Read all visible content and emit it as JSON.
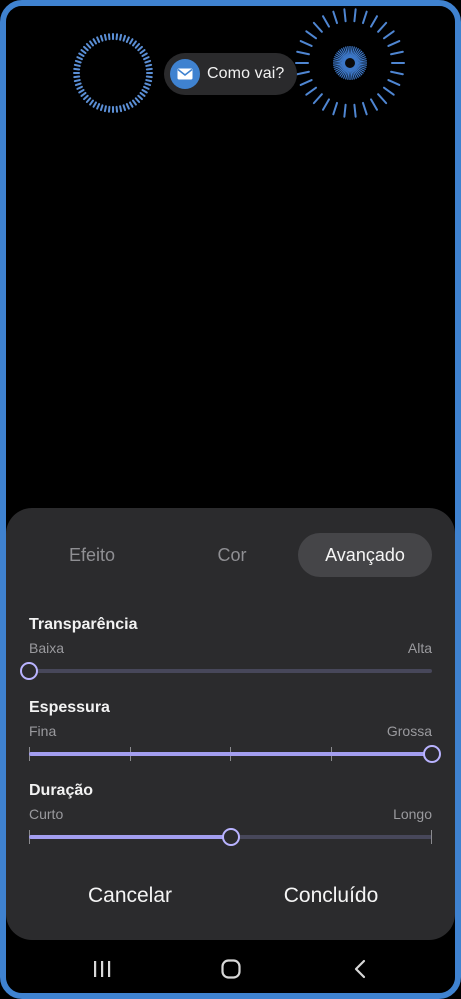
{
  "notification": {
    "text": "Como vai?",
    "icon": "envelope-icon",
    "accent": "#3f82d0"
  },
  "edge_lighting": {
    "color": "#3f82d0"
  },
  "tabs": [
    {
      "label": "Efeito",
      "active": false
    },
    {
      "label": "Cor",
      "active": false
    },
    {
      "label": "Avançado",
      "active": true
    }
  ],
  "sliders": [
    {
      "title": "Transparência",
      "min_label": "Baixa",
      "max_label": "Alta",
      "steps": 0,
      "value": 0
    },
    {
      "title": "Espessura",
      "min_label": "Fina",
      "max_label": "Grossa",
      "steps": 4,
      "value": 1
    },
    {
      "title": "Duração",
      "min_label": "Curto",
      "max_label": "Longo",
      "steps": 2,
      "value": 0.5
    }
  ],
  "actions": {
    "cancel_label": "Cancelar",
    "done_label": "Concluído"
  },
  "navbar": {
    "recents_icon": "recents-icon",
    "home_icon": "home-icon",
    "back_icon": "back-icon"
  },
  "colors": {
    "slider_fill": "#a39ef0",
    "slider_track": "#47475a",
    "panel": "#2b2b2d"
  }
}
